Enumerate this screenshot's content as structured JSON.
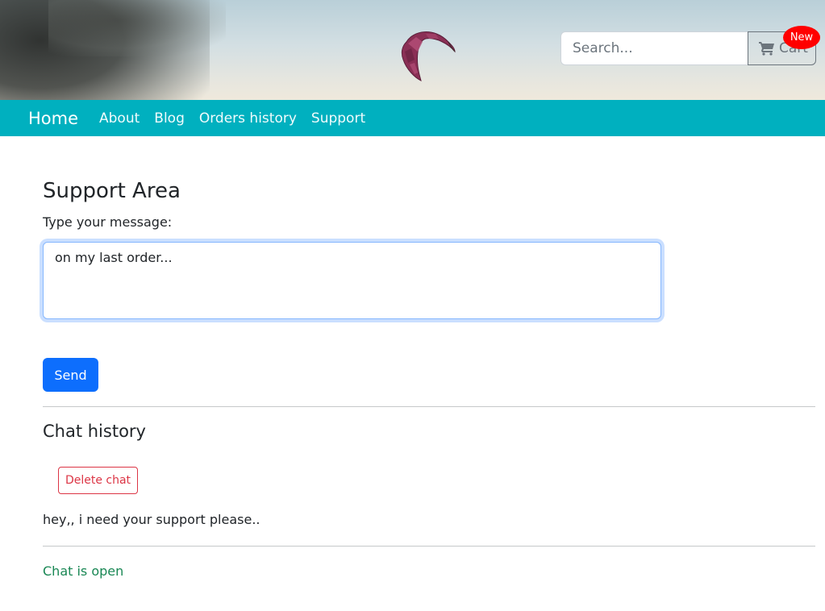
{
  "header": {
    "search": {
      "placeholder": "Search...",
      "value": ""
    },
    "cart": {
      "label": "Cart",
      "icon": "shopping-cart-icon",
      "badge": "New",
      "badge_color": "#ff0000"
    },
    "hero_image": "kite-over-beach"
  },
  "nav": {
    "brand": "Home",
    "links": [
      {
        "label": "About"
      },
      {
        "label": "Blog"
      },
      {
        "label": "Orders history"
      },
      {
        "label": "Support"
      }
    ],
    "background_color": "#00b0bf"
  },
  "support": {
    "title": "Support Area",
    "message_label": "Type your message:",
    "message_value": "on my last order...",
    "send_label": "Send"
  },
  "chat": {
    "title": "Chat history",
    "delete_label": "Delete chat",
    "messages": [
      {
        "text": "hey,, i need your support please.."
      }
    ],
    "status": "Chat is open",
    "status_color": "#198754"
  },
  "colors": {
    "primary": "#0d6efd",
    "danger": "#dc3545",
    "success": "#198754"
  }
}
